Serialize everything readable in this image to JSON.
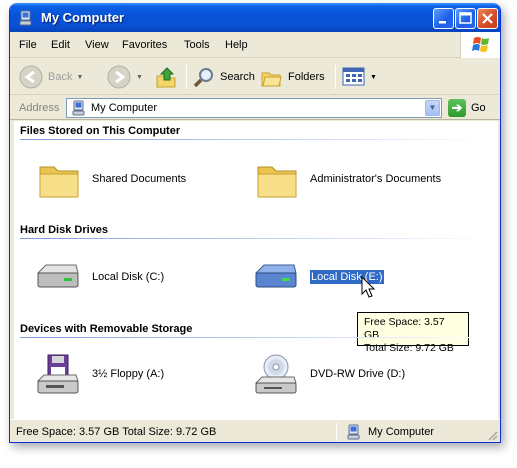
{
  "window": {
    "title": "My Computer",
    "controls": [
      "minimize-icon",
      "maximize-icon",
      "close-icon"
    ]
  },
  "menu": {
    "items": [
      "File",
      "Edit",
      "View",
      "Favorites",
      "Tools",
      "Help"
    ]
  },
  "toolbar": {
    "back_label": "Back",
    "search_label": "Search",
    "folders_label": "Folders"
  },
  "address": {
    "label": "Address",
    "value": "My Computer",
    "go_label": "Go"
  },
  "groups": {
    "files_stored": {
      "title": "Files Stored on This Computer",
      "items": [
        "Shared Documents",
        "Administrator's Documents"
      ]
    },
    "hard_disks": {
      "title": "Hard Disk Drives",
      "items": [
        "Local Disk (C:)",
        "Local Disk (E:)"
      ]
    },
    "removable": {
      "title": "Devices with Removable Storage",
      "items": [
        "3½ Floppy (A:)",
        "DVD-RW Drive (D:)"
      ]
    }
  },
  "tooltip": {
    "line1": "Free Space: 3.57 GB",
    "line2": "Total Size: 9.72 GB"
  },
  "status": {
    "left": "Free Space: 3.57 GB Total Size: 9.72 GB",
    "right": "My Computer"
  },
  "colors": {
    "titlebar": "#0a5fe4",
    "selection": "#316ac5",
    "tooltip_bg": "#ffffe1"
  }
}
